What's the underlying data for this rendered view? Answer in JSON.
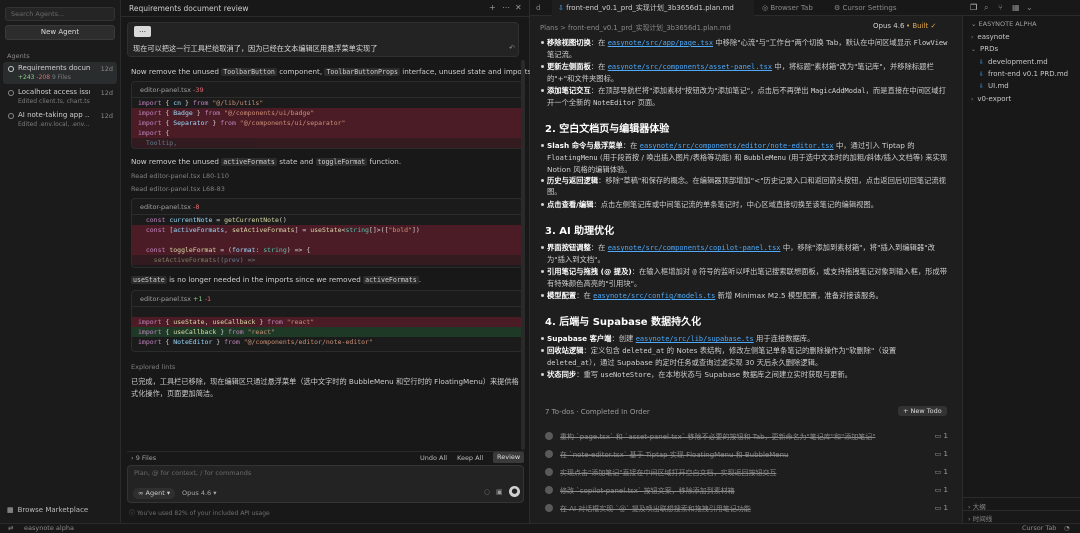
{
  "left": {
    "search_placeholder": "Search Agents...",
    "new_agent": "New Agent",
    "section": "Agents",
    "agents": [
      {
        "title": "Requirements docum...",
        "sub_added": "+243",
        "sub_removed": "-208",
        "sub_files": "9 Files",
        "time": "12d"
      },
      {
        "title": "Localhost access issue",
        "sub": "Edited client.ts, chart.ts...",
        "time": "12d"
      },
      {
        "title": "AI note-taking app ...",
        "sub": "Edited .env.local, .env...",
        "time": "12d"
      }
    ],
    "marketplace": "Browse Marketplace"
  },
  "mid": {
    "title": "Requirements document review",
    "user_message": "现在可以把这一行工具栏给取消了，因为已经在文本编辑区用悬浮菜单实现了",
    "msg1": "Now remove the unused",
    "msg1_code1": "ToolbarButton",
    "msg1_mid": "component,",
    "msg1_code2": "ToolbarButtonProps",
    "msg1_end": "interface, unused state and imports.",
    "block1": {
      "file": "editor-panel.tsx",
      "delta": "-39"
    },
    "msg2": "Now remove the unused",
    "msg2_code1": "activeFormats",
    "msg2_mid": "state and",
    "msg2_code2": "toggleFormat",
    "msg2_end": "function.",
    "read1": "Read editor-panel.tsx L80-110",
    "read2": "Read editor-panel.tsx L68-83",
    "block2": {
      "file": "editor-panel.tsx",
      "delta": "-8"
    },
    "msg3_code1": "useState",
    "msg3_mid": "is no longer needed in the imports since we removed",
    "msg3_code2": "activeFormats",
    "msg3_end": ".",
    "block3": {
      "file": "editor-panel.tsx",
      "add": "+1",
      "del": "-1"
    },
    "explored": "Explored lints",
    "summary1": "已完成，工具栏已移除，现在编辑区只通过悬浮菜单（选中文字时的 BubbleMenu 和空行时的 FloatingMenu）来提供格",
    "summary2": "式化操作，页面更加简洁。",
    "files": "9 Files",
    "undo_all": "Undo All",
    "keep_all": "Keep All",
    "review": "Review",
    "input_placeholder": "Plan, @ for context, / for commands",
    "mode": "Agent",
    "model": "Opus 4.6",
    "usage": "You've used 82% of your included API usage"
  },
  "doc": {
    "tabs": [
      "d",
      "front-end_v0.1_prd_实现计划_3b3656d1.plan.md",
      "Browser Tab",
      "Cursor Settings"
    ],
    "breadcrumb": "Plans  >  front-end_v0.1_prd_实现计划_3b3656d1.plan.md",
    "model": "Opus 4.6",
    "built": "Built",
    "s2": "2. 空白文档页与编辑器体验",
    "s3": "3. AI 助理优化",
    "s4": "4. 后端与 Supabase 数据持久化",
    "todos_header": "7 To-dos · Completed In Order",
    "new_todo": "+ New Todo",
    "todos": [
      "重构 `page.tsx` 和 `asset-panel.tsx` 移除不必要的按钮和 Tab，更新命名为\"笔记库\"和\"添加笔记\"",
      "在 `note-editor.tsx` 基于 Tiptap 实现 FloatingMenu 和 BubbleMenu",
      "实现点击\"添加笔记\"直接在中间区域打开空白文档，实现返回按钮交互",
      "修改 `copilot-panel.tsx` 按钮文案，移除添加到素材箱",
      "在 AI 对话框实现 `@` 提及唤出联想搜索和拖拽引用笔记功能"
    ],
    "todo_count": "1"
  },
  "right": {
    "header": "EASYNOTE ALPHA",
    "tree": [
      {
        "label": "easynote",
        "type": "folder"
      },
      {
        "label": "PRDs",
        "type": "folder-open"
      },
      {
        "label": "development.md",
        "type": "file"
      },
      {
        "label": "front-end v0.1 PRD.md",
        "type": "file"
      },
      {
        "label": "UI.md",
        "type": "file"
      },
      {
        "label": "v0-export",
        "type": "folder"
      }
    ],
    "outline": "大纲",
    "timeline": "时间线"
  },
  "status": {
    "workspace": "easynote alpha",
    "right": "Cursor Tab"
  }
}
